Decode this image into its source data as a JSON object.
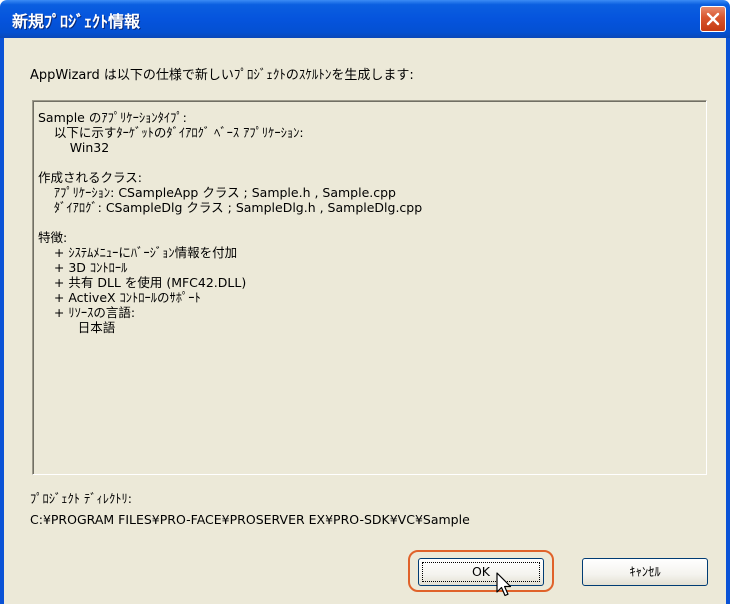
{
  "dialog": {
    "title": "新規ﾌﾟﾛｼﾞｪｸﾄ情報",
    "intro": "AppWizard は以下の仕様で新しいﾌﾟﾛｼﾞｪｸﾄのｽｹﾙﾄﾝを生成します:",
    "info_lines": [
      "Sample のｱﾌﾟﾘｹｰｼｮﾝﾀｲﾌﾟ:",
      "    以下に示すﾀｰｹﾞｯﾄのﾀﾞｲｱﾛｸﾞ ﾍﾞｰｽ ｱﾌﾟﾘｹｰｼｮﾝ:",
      "        Win32",
      "",
      "作成されるクラス:",
      "    ｱﾌﾟﾘｹｰｼｮﾝ: CSampleApp クラス ; Sample.h , Sample.cpp",
      "    ﾀﾞｲｱﾛｸﾞ: CSampleDlg クラス ; SampleDlg.h , SampleDlg.cpp",
      "",
      "特徴:",
      "    + ｼｽﾃﾑﾒﾆｭｰにﾊﾞｰｼﾞｮﾝ情報を付加",
      "    + 3D ｺﾝﾄﾛｰﾙ",
      "    + 共有 DLL を使用 (MFC42.DLL)",
      "    + ActiveX ｺﾝﾄﾛｰﾙのｻﾎﾟｰﾄ",
      "    + ﾘｿｰｽの言語:",
      "          日本語"
    ],
    "directory_label": "ﾌﾟﾛｼﾞｪｸﾄ ﾃﾞｨﾚｸﾄﾘ:",
    "directory_value": "C:¥PROGRAM FILES¥PRO-FACE¥PROSERVER EX¥PRO-SDK¥VC¥Sample",
    "ok_label": "OK",
    "cancel_label": "ｷｬﾝｾﾙ",
    "close_icon": "close-icon",
    "colors": {
      "title_bar": "#0554dd",
      "close_button": "#d8552d",
      "highlight": "#e0622a",
      "dialog_bg": "#ece9d8"
    }
  }
}
